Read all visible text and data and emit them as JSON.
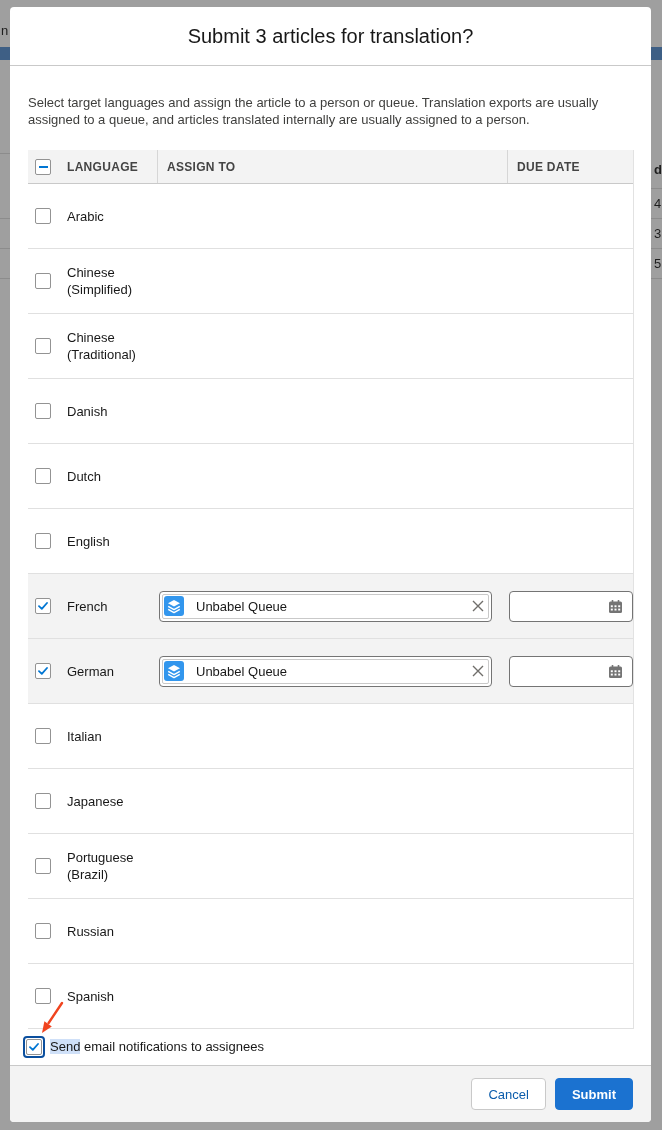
{
  "background_page": {
    "menu_text": "n",
    "column_header": "d",
    "cells": [
      "4",
      "3",
      "5"
    ]
  },
  "dialog": {
    "title": "Submit 3 articles for translation?",
    "description": "Select target languages and assign the article to a person or queue. Translation exports are usually assigned to a queue, and articles translated internally are usually assigned to a person."
  },
  "table": {
    "select_all": {
      "indeterminate": true
    },
    "columns": [
      {
        "label": "LANGUAGE"
      },
      {
        "label": "ASSIGN TO"
      },
      {
        "label": "DUE DATE"
      }
    ],
    "rows": [
      {
        "language": "Arabic",
        "checked": false
      },
      {
        "language": "Chinese (Simplified)",
        "checked": false
      },
      {
        "language": "Chinese (Traditional)",
        "checked": false
      },
      {
        "language": "Danish",
        "checked": false
      },
      {
        "language": "Dutch",
        "checked": false
      },
      {
        "language": "English",
        "checked": false
      },
      {
        "language": "French",
        "checked": true,
        "assign_to": {
          "kind": "queue",
          "name": "Unbabel Queue"
        }
      },
      {
        "language": "German",
        "checked": true,
        "assign_to": {
          "kind": "queue",
          "name": "Unbabel Queue"
        }
      },
      {
        "language": "Italian",
        "checked": false
      },
      {
        "language": "Japanese",
        "checked": false
      },
      {
        "language": "Portuguese (Brazil)",
        "checked": false
      },
      {
        "language": "Russian",
        "checked": false
      },
      {
        "language": "Spanish",
        "checked": false
      }
    ]
  },
  "notification": {
    "checked": true,
    "focused": true,
    "selected_text": "Send",
    "text": "email notifications to assignees"
  },
  "annotations": [
    {
      "kind": "arrow"
    }
  ],
  "buttons": [
    {
      "label": "Cancel",
      "kind": "neutral"
    },
    {
      "label": "Submit",
      "kind": "brand"
    }
  ]
}
